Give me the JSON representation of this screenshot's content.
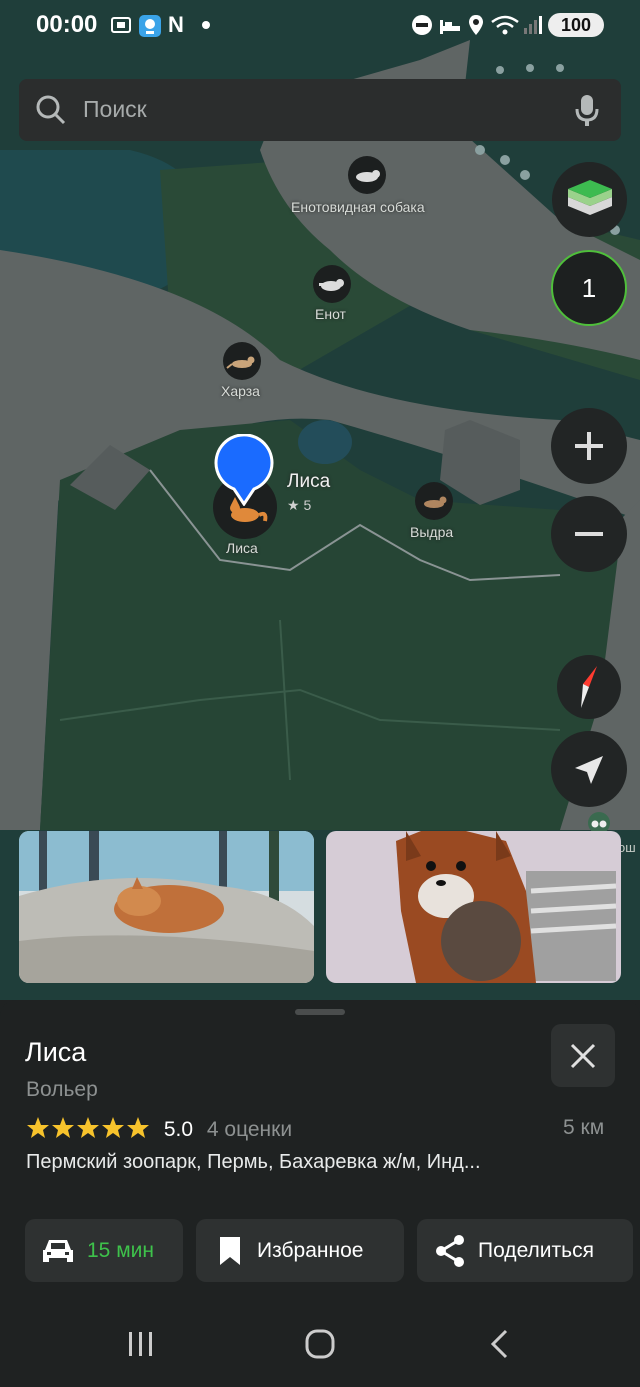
{
  "status_bar": {
    "time": "00:00",
    "notification_letter": "N",
    "battery": "100"
  },
  "search": {
    "placeholder": "Поиск"
  },
  "map": {
    "layers_badge": "1",
    "animals": [
      {
        "name": "Енотовидная собака"
      },
      {
        "name": "Енот"
      },
      {
        "name": "Харза"
      },
      {
        "name": "Лиса"
      },
      {
        "name": "Выдра"
      }
    ],
    "selected": {
      "name": "Лиса",
      "rating": "5"
    }
  },
  "place": {
    "title": "Лиса",
    "category": "Вольер",
    "rating": "5.0",
    "reviews": "4 оценки",
    "distance": "5 км",
    "address": "Пермский зоопарк, Пермь, Бахаревка ж/м, Инд..."
  },
  "actions": {
    "route": "15 мин",
    "favorite": "Избранное",
    "share": "Поделиться"
  },
  "colors": {
    "route_green": "#3ec24b",
    "star": "#f7c32c",
    "pin_blue": "#1a6bff"
  }
}
